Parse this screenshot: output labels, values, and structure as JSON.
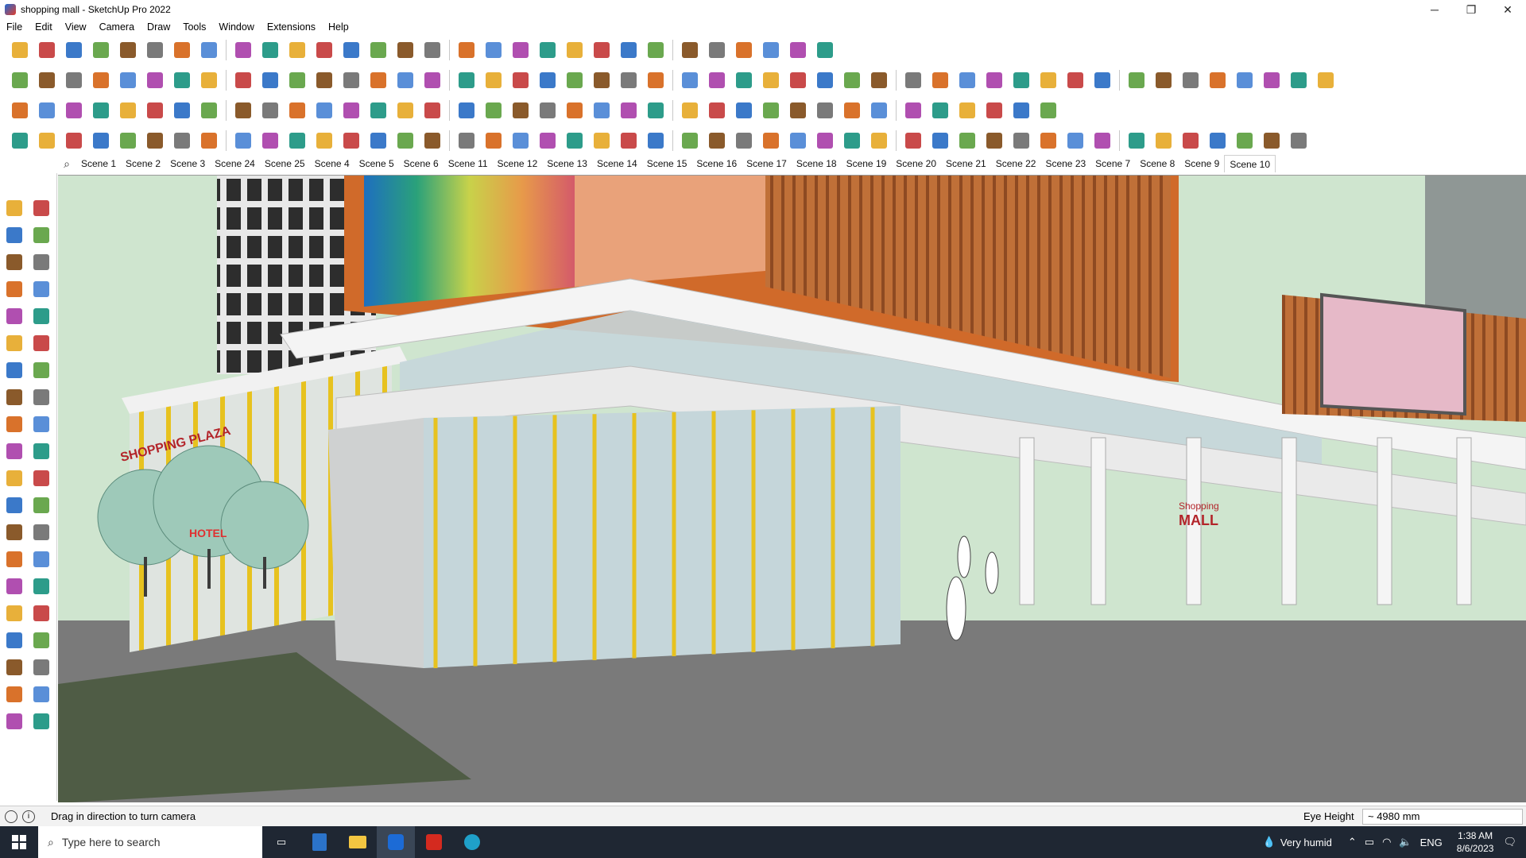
{
  "window": {
    "title": "shopping mall - SketchUp Pro 2022",
    "minimize": "─",
    "maximize": "❐",
    "close": "✕"
  },
  "menu": [
    "File",
    "Edit",
    "View",
    "Camera",
    "Draw",
    "Tools",
    "Window",
    "Extensions",
    "Help"
  ],
  "scenes": {
    "tabs": [
      "Scene 1",
      "Scene 2",
      "Scene 3",
      "Scene 24",
      "Scene 25",
      "Scene 4",
      "Scene 5",
      "Scene 6",
      "Scene 11",
      "Scene 12",
      "Scene 13",
      "Scene 14",
      "Scene 15",
      "Scene 16",
      "Scene 17",
      "Scene 18",
      "Scene 19",
      "Scene 20",
      "Scene 21",
      "Scene 22",
      "Scene 23",
      "Scene 7",
      "Scene 8",
      "Scene 9",
      "Scene 10"
    ],
    "active": "Scene 10"
  },
  "viewport": {
    "signs": {
      "plaza": "SHOPPING PLAZA",
      "mall_top": "Shopping",
      "mall_bottom": "MALL",
      "hotel": "HOTEL"
    }
  },
  "status": {
    "message": "Drag in direction to turn camera",
    "eye_height_label": "Eye Height",
    "eye_height_value": "~ 4980 mm"
  },
  "taskbar": {
    "search_placeholder": "Type here to search",
    "weather": "Very humid",
    "language": "ENG",
    "time": "1:38 AM",
    "date": "8/6/2023"
  },
  "colors": {
    "sky": "#cfe5cf",
    "orange_frame": "#d06a2a",
    "wood_slats": "#b8662e",
    "ground": "#777777",
    "lawn": "#5a6b4a",
    "yellow_mullion": "#e7c21f",
    "glass": "#c5d6da"
  }
}
